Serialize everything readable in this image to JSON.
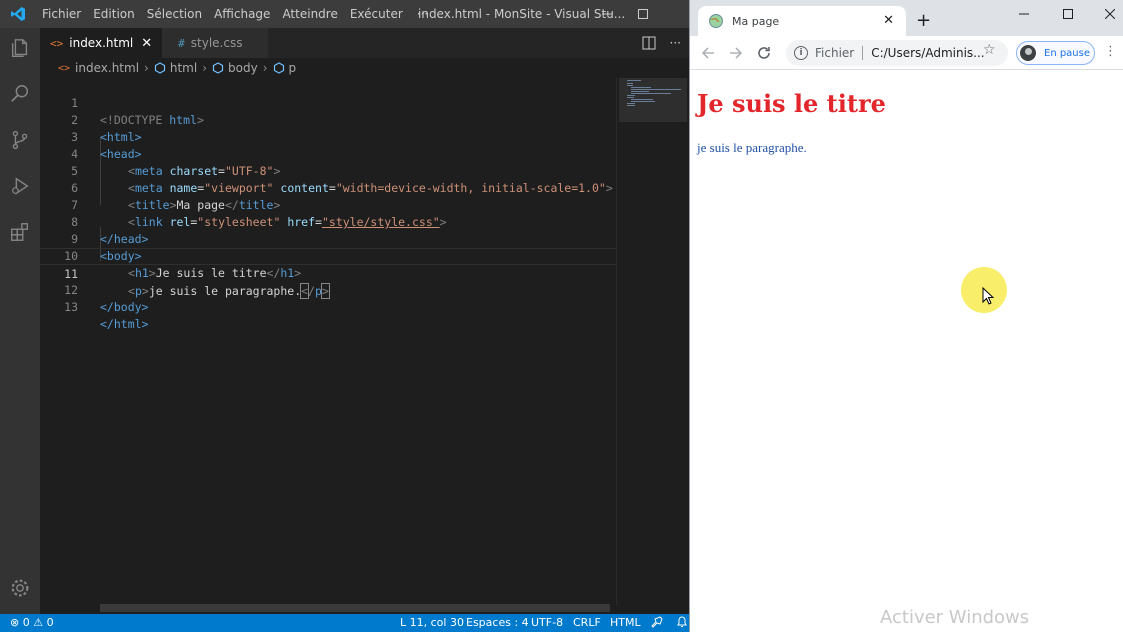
{
  "vscode": {
    "menu": [
      "Fichier",
      "Edition",
      "Sélection",
      "Affichage",
      "Atteindre",
      "Exécuter"
    ],
    "menu_more": "···",
    "window_title": "index.html - MonSite - Visual Stu...",
    "tabs": [
      {
        "label": "index.html",
        "icon": "<>",
        "active": true
      },
      {
        "label": "style.css",
        "icon": "#",
        "active": false
      }
    ],
    "breadcrumb": [
      "index.html",
      "html",
      "body",
      "p"
    ],
    "line_numbers": [
      "1",
      "2",
      "3",
      "4",
      "5",
      "6",
      "7",
      "8",
      "9",
      "10",
      "11",
      "12",
      "13"
    ],
    "code": {
      "l1_doctype": "<!DOCTYPE",
      "l1_html": " html",
      "l1_close": ">",
      "open_html": "<html>",
      "open_head": "<head>",
      "meta": "meta",
      "charset_attr": "charset",
      "charset_val": "\"UTF-8\"",
      "name_attr": "name",
      "name_val": "\"viewport\"",
      "content_attr": "content",
      "content_val": "\"width=device-width, initial-scale=1.0\"",
      "title_tag": "title",
      "title_text": "Ma page",
      "link_tag": "link",
      "rel_attr": "rel",
      "rel_val": "\"stylesheet\"",
      "href_attr": "href",
      "href_val": "\"style/style.css\"",
      "close_head": "</head>",
      "open_body": "<body>",
      "h1_tag": "h1",
      "h1_text": "Je suis le titre",
      "p_tag": "p",
      "p_text": "je suis le paragraphe.",
      "close_body": "</body>",
      "close_html": "</html>"
    },
    "status": {
      "errors": "0",
      "warnings": "0",
      "position": "L 11, col 30",
      "spaces": "Espaces : 4",
      "encoding": "UTF-8",
      "eol": "CRLF",
      "language": "HTML"
    },
    "accent_color": "#007acc"
  },
  "chrome": {
    "tab_title": "Ma page",
    "new_tab": "+",
    "omnibox_label": "Fichier",
    "omnibox_url": "C:/Users/Adminis...",
    "profile_label": "En pause",
    "page": {
      "h1": "Je suis le titre",
      "p": "je suis le paragraphe.",
      "h1_color": "#e3262b",
      "p_color": "#2050a8"
    }
  },
  "watermark": "Activer Windows"
}
